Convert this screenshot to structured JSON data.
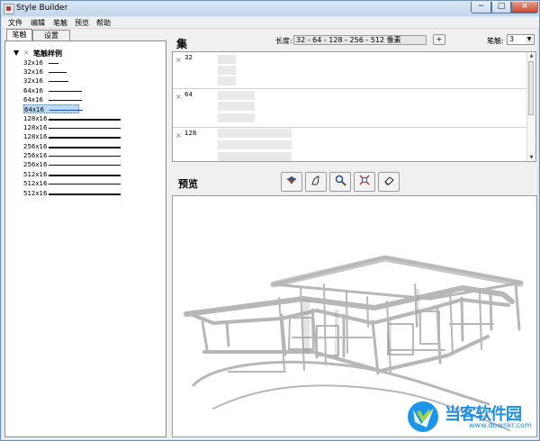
{
  "window": {
    "title": "Style Builder"
  },
  "menu": [
    "文件",
    "编辑",
    "笔触",
    "预览",
    "帮助"
  ],
  "left": {
    "tabs": [
      "笔触",
      "设置"
    ],
    "tree_root": "笔触样例",
    "items": [
      "32x16",
      "32x16",
      "32x16",
      "64x16",
      "64x16",
      "64x16",
      "128x16",
      "128x16",
      "128x16",
      "256x16",
      "256x16",
      "256x16",
      "512x16",
      "512x16",
      "512x16"
    ]
  },
  "set": {
    "header": "集",
    "length_label": "长度:",
    "length_value": "32 - 64 - 128 - 256 - 512 像素",
    "plus": "+",
    "stroke_label": "笔触:",
    "stroke_value": "3",
    "rows": [
      "32",
      "64",
      "128"
    ]
  },
  "preview": {
    "title": "预览"
  },
  "watermark": {
    "main": "当客软件园",
    "sub": "www.downkr.com"
  },
  "icons": {
    "minimize": "−",
    "maximize": "□",
    "close": "×",
    "tree_toggle": "▼",
    "tree_close": "×",
    "select_arrow": "▼",
    "scroll_up": "▲",
    "scroll_down": "▼"
  }
}
